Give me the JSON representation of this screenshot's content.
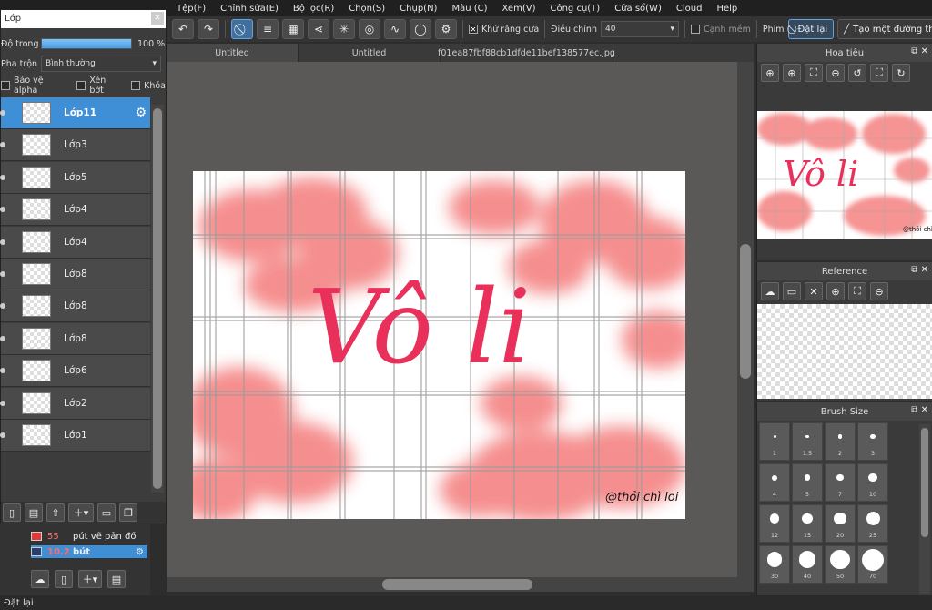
{
  "menu": [
    "Tệp(F)",
    "Chỉnh sửa(E)",
    "Bộ lọc(R)",
    "Chọn(S)",
    "Chụp(N)",
    "Màu (C)",
    "Xem(V)",
    "Công cụ(T)",
    "Cửa sổ(W)",
    "Cloud",
    "Help"
  ],
  "toolbar": {
    "antialias_label": "Khử răng cưa",
    "adjust_label": "Điều chỉnh",
    "adjust_value": "40",
    "soft_edge_label": "Cạnh mềm",
    "key_label": "Phím",
    "reset_label": "Đặt lại",
    "line_label": "Tạo một đường thẳng"
  },
  "tabs": [
    "Untitled",
    "Untitled",
    "f01ea87fbf88cb1dfde11bef138577ec.jpg"
  ],
  "layer_panel": {
    "title": "Lớp",
    "opacity_label": "Độ trong",
    "opacity_value": "100 %",
    "opacity_fraction": 1.0,
    "blend_label": "Pha trộn",
    "blend_value": "Bình thường",
    "protect_alpha": "Bảo vệ alpha",
    "clipping": "Xén bớt",
    "lock": "Khóa",
    "layers": [
      "Lớp11",
      "Lớp3",
      "Lớp5",
      "Lớp4",
      "Lớp4",
      "Lớp8",
      "Lớp8",
      "Lớp8",
      "Lớp6",
      "Lớp2",
      "Lớp1"
    ],
    "selected_index": 0
  },
  "brush_list": [
    {
      "size": "55",
      "name": "pút vẽ pản đồ",
      "color": "#e23a3a"
    },
    {
      "size": "10.2",
      "name": "bút",
      "color": "#2a3f6e"
    }
  ],
  "artwork": {
    "text": "Vô li",
    "signature": "@thỏi chì loi"
  },
  "navigator": {
    "title": "Hoa tiêu"
  },
  "reference": {
    "title": "Reference"
  },
  "brush_size": {
    "title": "Brush Size",
    "sizes": [
      "1",
      "1.5",
      "2",
      "3",
      "4",
      "5",
      "7",
      "10",
      "12",
      "15",
      "20",
      "25",
      "30",
      "40",
      "50",
      "70"
    ]
  },
  "status": "Đặt lại",
  "colors": {
    "accent": "#3f8fd6",
    "paint": "#f36f6f",
    "ink": "#e8305a"
  }
}
